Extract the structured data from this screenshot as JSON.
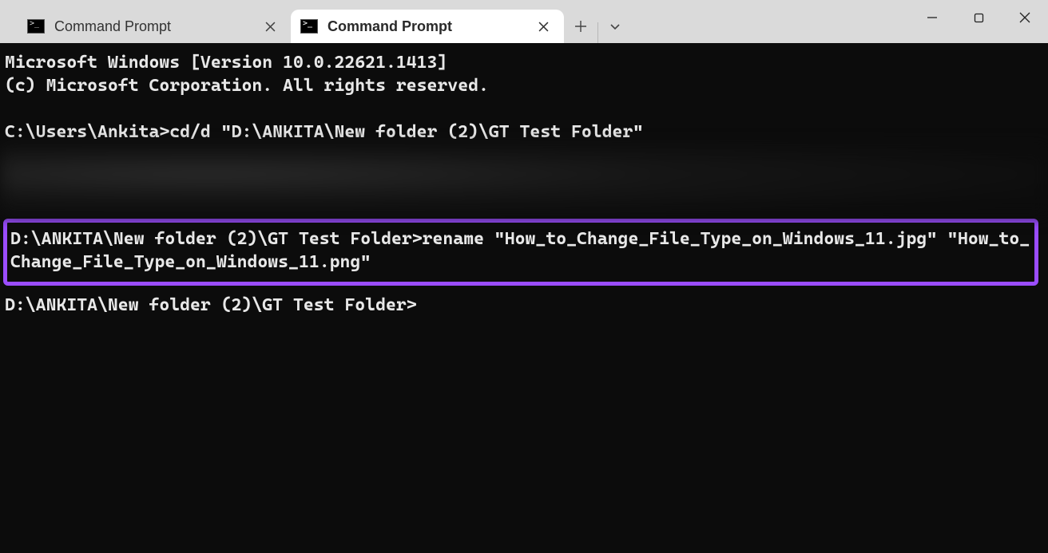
{
  "tabs": [
    {
      "label": "Command Prompt",
      "active": false
    },
    {
      "label": "Command Prompt",
      "active": true
    }
  ],
  "terminal": {
    "line1": "Microsoft Windows [Version 10.0.22621.1413]",
    "line2": "(c) Microsoft Corporation. All rights reserved.",
    "blank1": "",
    "prompt1": "C:\\Users\\Ankita>",
    "cmd1": "cd/d \"D:\\ANKITA\\New folder (2)\\GT Test Folder\"",
    "highlighted": "D:\\ANKITA\\New folder (2)\\GT Test Folder>rename \"How_to_Change_File_Type_on_Windows_11.jpg\" \"How_to_Change_File_Type_on_Windows_11.png\"",
    "prompt2": "D:\\ANKITA\\New folder (2)\\GT Test Folder>"
  },
  "colors": {
    "highlight_border": "#9b4dff",
    "terminal_bg": "#0c0c0c",
    "terminal_fg": "#e8e8e8",
    "titlebar_bg": "#dadada",
    "active_tab_bg": "#ffffff"
  }
}
